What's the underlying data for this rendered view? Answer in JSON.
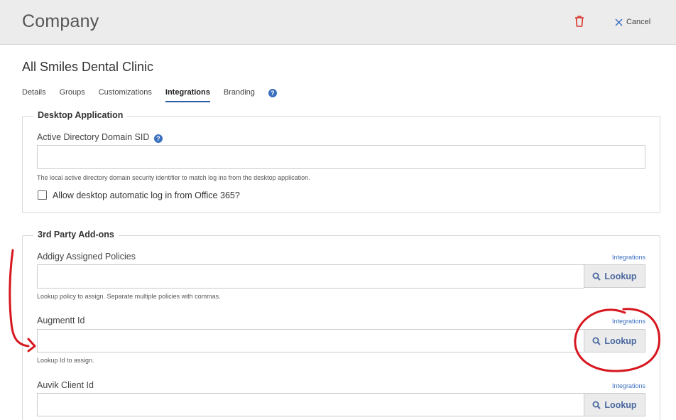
{
  "header": {
    "title": "Company",
    "cancel_label": "Cancel",
    "delete_icon": "trash-icon",
    "cancel_icon": "close-icon"
  },
  "company": {
    "name": "All Smiles Dental Clinic"
  },
  "tabs": [
    {
      "label": "Details",
      "active": false
    },
    {
      "label": "Groups",
      "active": false
    },
    {
      "label": "Customizations",
      "active": false
    },
    {
      "label": "Integrations",
      "active": true
    },
    {
      "label": "Branding",
      "active": false
    }
  ],
  "help_glyph": "?",
  "desktop": {
    "legend": "Desktop Application",
    "sid_label": "Active Directory Domain SID",
    "sid_value": "",
    "sid_hint": "The local active directory domain security identifier to match log ins from the desktop application.",
    "auto_login_label": "Allow desktop automatic log in from Office 365?",
    "auto_login_checked": false
  },
  "addons": {
    "legend": "3rd Party Add-ons",
    "link_label": "Integrations",
    "lookup_label": "Lookup",
    "fields": [
      {
        "label": "Addigy Assigned Policies",
        "value": "",
        "hint": "Lookup policy to assign. Separate multiple policies with commas."
      },
      {
        "label": "Augmentt Id",
        "value": "",
        "hint": "Lookup Id to assign."
      },
      {
        "label": "Auvik Client Id",
        "value": "",
        "hint": ""
      }
    ]
  },
  "colors": {
    "accent": "#2c5fa8",
    "link": "#3b6fbf",
    "annotation": "#d7171f",
    "delete": "#d9342b"
  }
}
